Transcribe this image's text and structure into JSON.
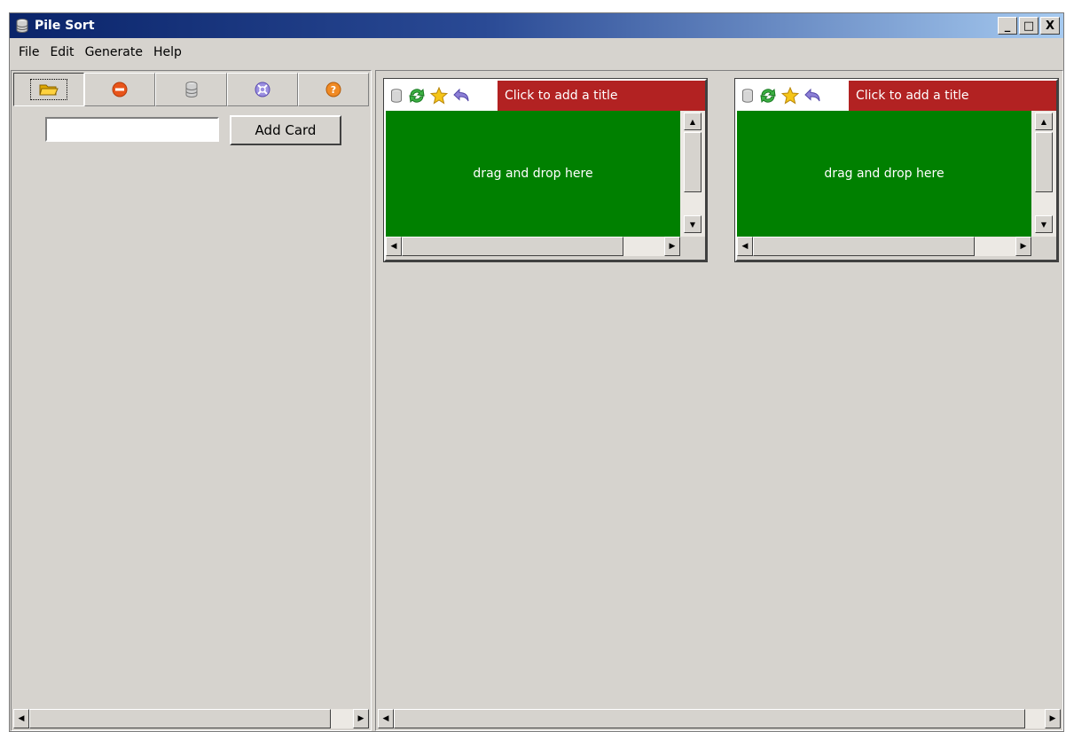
{
  "window": {
    "title": "Pile Sort",
    "minimize": "_",
    "maximize": "□",
    "close": "X"
  },
  "menu": [
    "File",
    "Edit",
    "Generate",
    "Help"
  ],
  "toolbar": {
    "buttons": [
      {
        "icon": "open-folder-icon"
      },
      {
        "icon": "remove-icon"
      },
      {
        "icon": "database-icon"
      },
      {
        "icon": "settings-icon"
      },
      {
        "icon": "help-icon"
      }
    ]
  },
  "card_input": {
    "value": ""
  },
  "add_card_label": "Add Card",
  "piles": [
    {
      "title": "Click to add a title",
      "body": "drag and drop here"
    },
    {
      "title": "Click to add a title",
      "body": "drag and drop here"
    }
  ],
  "colors": {
    "pile_title_bg": "#b22222",
    "pile_body_bg": "#008000",
    "window_bg": "#d6d3ce"
  }
}
